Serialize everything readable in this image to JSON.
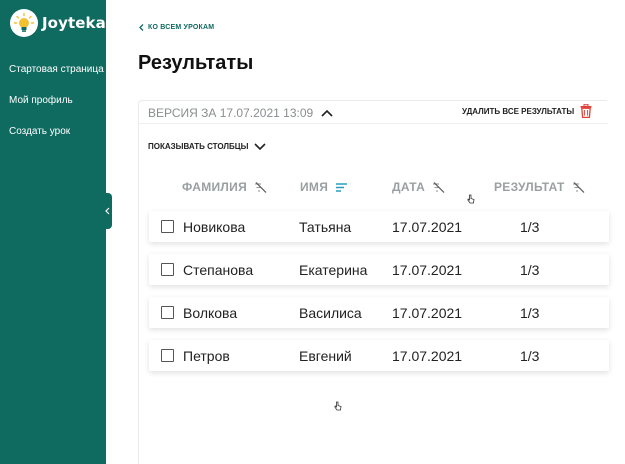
{
  "brand": {
    "name": "Joyteka",
    "accent": "#0f6a60"
  },
  "sidebar": {
    "items": [
      {
        "label": "Стартовая страница"
      },
      {
        "label": "Мой профиль"
      },
      {
        "label": "Создать урок"
      }
    ]
  },
  "main": {
    "back_label": "КО ВСЕМ УРОКАМ",
    "title": "Результаты",
    "version_label": "ВЕРСИЯ ЗА 17.07.2021 13:09",
    "delete_all_label": "УДАЛИТЬ ВСЕ РЕЗУЛЬТАТЫ",
    "show_columns_label": "ПОКАЗЫВАТЬ СТОЛБЦЫ",
    "columns": [
      "ФАМИЛИЯ",
      "ИМЯ",
      "ДАТА",
      "РЕЗУЛЬТАТ"
    ],
    "rows": [
      {
        "surname": "Новикова",
        "name": "Татьяна",
        "date": "17.07.2021",
        "result": "1/3"
      },
      {
        "surname": "Степанова",
        "name": "Екатерина",
        "date": "17.07.2021",
        "result": "1/3"
      },
      {
        "surname": "Волкова",
        "name": "Василиса",
        "date": "17.07.2021",
        "result": "1/3"
      },
      {
        "surname": "Петров",
        "name": "Евгений",
        "date": "17.07.2021",
        "result": "1/3"
      }
    ]
  },
  "icons": {
    "logo": "lightbulb-icon",
    "back": "chevron-left-icon",
    "version_toggle": "chevron-up-icon",
    "delete": "trash-icon",
    "show_columns": "chevron-down-icon",
    "sort_off": "sort-disabled-icon",
    "sort_active": "sort-icon"
  }
}
